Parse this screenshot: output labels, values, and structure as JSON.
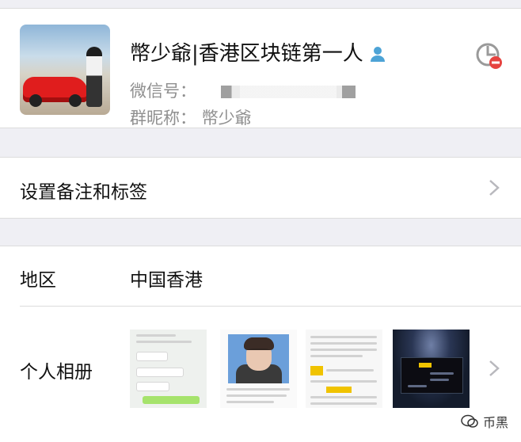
{
  "profile": {
    "name": "幣少爺|香港区块链第一人",
    "wechat_id_label": "微信号：",
    "group_nickname_label": "群昵称：",
    "group_nickname_value": "幣少爺"
  },
  "settings": {
    "remark_and_tags_label": "设置备注和标签"
  },
  "region": {
    "label": "地区",
    "value": "中国香港"
  },
  "album": {
    "label": "个人相册"
  },
  "watermark": {
    "text": "币黑"
  },
  "colors": {
    "background": "#efeff4",
    "card": "#ffffff",
    "text_primary": "#111111",
    "text_secondary": "#8f8f8f",
    "divider": "#dcdcdc",
    "person_icon_blue": "#4da3d6",
    "status_red": "#e64340"
  },
  "icons": {
    "verified_person": "person-icon",
    "status": "blocked-status-icon",
    "chevron": "chevron-right-icon",
    "watermark": "wechat-logo-icon"
  }
}
